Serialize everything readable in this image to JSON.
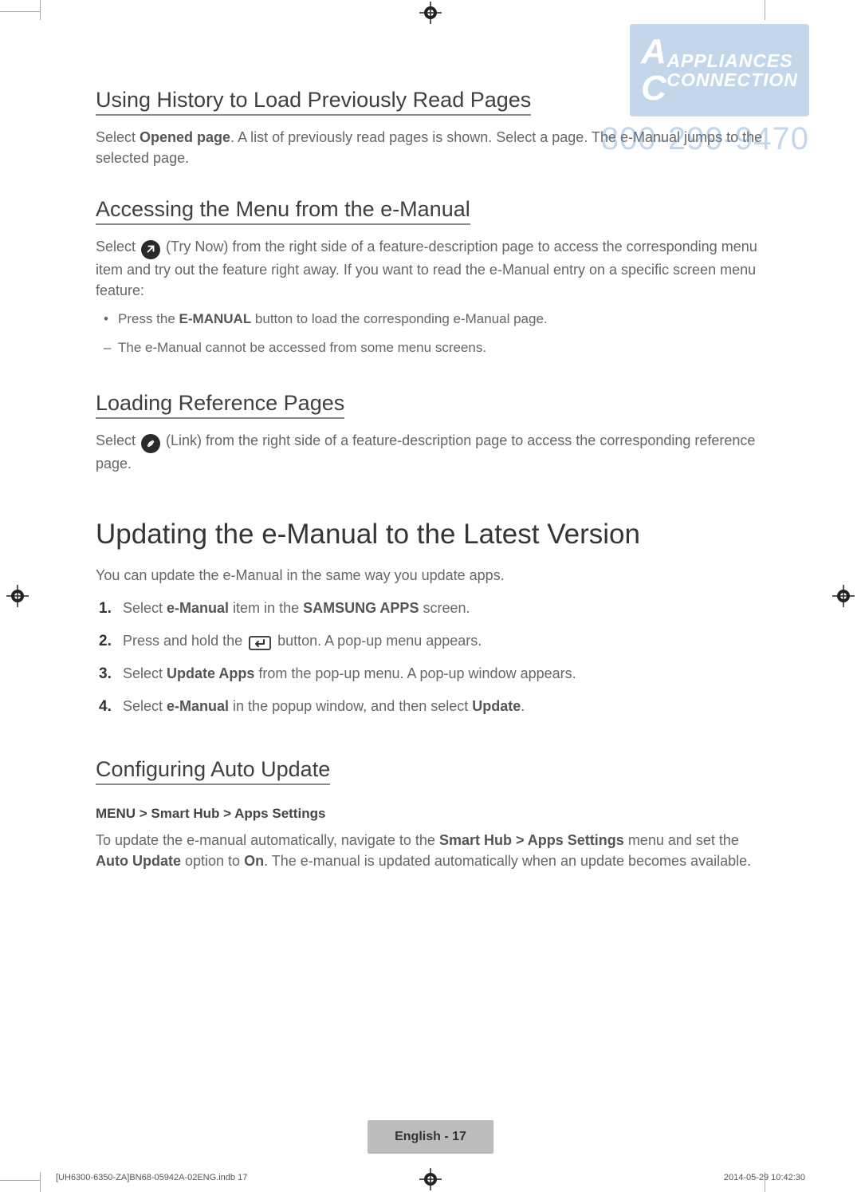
{
  "watermark": {
    "brand_line1": "APPLIANCES",
    "brand_line2": "CONNECTION",
    "phone": "800-299-9470"
  },
  "sections": {
    "history": {
      "heading": "Using History to Load Previously Read Pages",
      "p1a": "Select ",
      "p1b": "Opened page",
      "p1c": ". A list of previously read pages is shown. Select a page. The e-Manual jumps to the selected page."
    },
    "menu": {
      "heading": "Accessing the Menu from the e-Manual",
      "p1a": "Select ",
      "p1b": " (Try Now) from the right side of a feature-description page to access the corresponding menu item and try out the feature right away. If you want to read the e-Manual entry on a specific screen menu feature:",
      "b1a": "Press the ",
      "b1b": "E-MANUAL",
      "b1c": " button to load the corresponding e-Manual page.",
      "b2": "The e-Manual cannot be accessed from some menu screens."
    },
    "reference": {
      "heading": "Loading Reference Pages",
      "p1a": "Select ",
      "p1b": " (Link) from the right side of a feature-description page to access the corresponding reference page."
    },
    "updating": {
      "heading": "Updating the e-Manual to the Latest Version",
      "intro": "You can update the e-Manual in the same way you update apps.",
      "step1a": "Select ",
      "step1b": "e-Manual",
      "step1c": " item in the ",
      "step1d": "SAMSUNG APPS",
      "step1e": " screen.",
      "step2a": "Press and hold the ",
      "step2b": " button. A pop-up menu appears.",
      "step3a": "Select ",
      "step3b": "Update Apps",
      "step3c": " from the pop-up menu. A pop-up window appears.",
      "step4a": "Select ",
      "step4b": "e-Manual",
      "step4c": " in the popup window, and then select ",
      "step4d": "Update",
      "step4e": "."
    },
    "auto": {
      "heading": "Configuring Auto Update",
      "path": "MENU > Smart Hub > Apps Settings",
      "p1a": "To update the e-manual automatically, navigate to the ",
      "p1b": "Smart Hub > Apps Settings",
      "p1c": " menu and set the ",
      "p1d": "Auto Update",
      "p1e": " option to ",
      "p1f": "On",
      "p1g": ". The e-manual is updated automatically when an update becomes available."
    }
  },
  "footer": {
    "page_label": "English - 17",
    "doc_left": "[UH6300-6350-ZA]BN68-05942A-02ENG.indb   17",
    "doc_right": "2014-05-29   10:42:30"
  },
  "numbers": {
    "n1": "1.",
    "n2": "2.",
    "n3": "3.",
    "n4": "4."
  }
}
